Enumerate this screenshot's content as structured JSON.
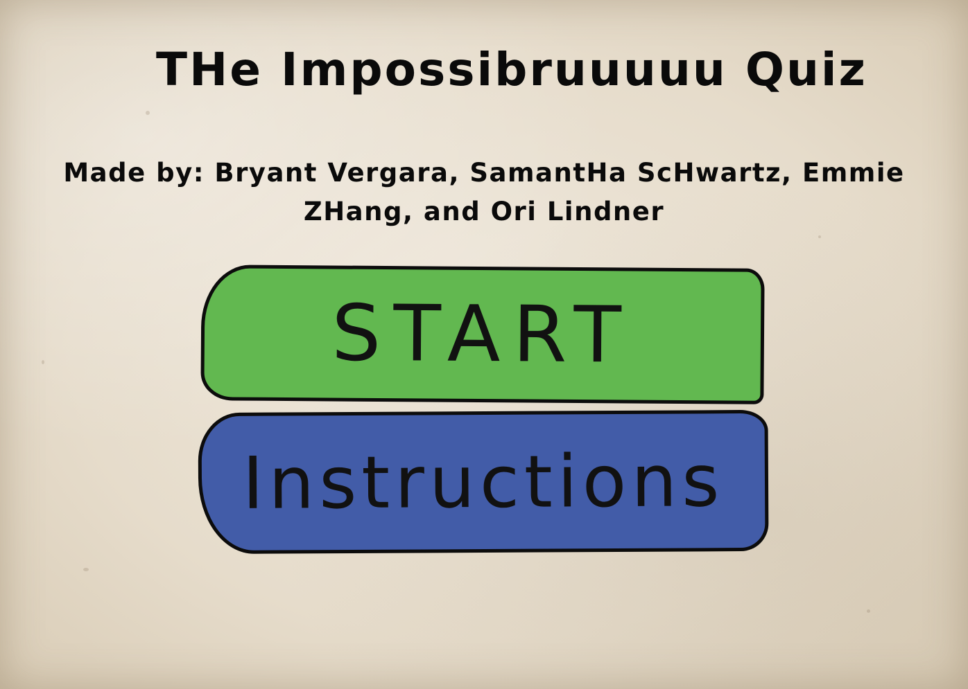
{
  "title": "THe Impossibruuuuu Quiz",
  "credits": {
    "line1": "Made by: Bryant Vergara, SamantHa ScHwartz, Emmie",
    "line2": "ZHang, and Ori Lindner"
  },
  "menu": {
    "start_label": "START",
    "instructions_label": "Instructions"
  },
  "colors": {
    "start_button": "#62b850",
    "instructions_button": "#425ca8",
    "outline": "#0c0c0c",
    "paper": "#e6dccb"
  }
}
